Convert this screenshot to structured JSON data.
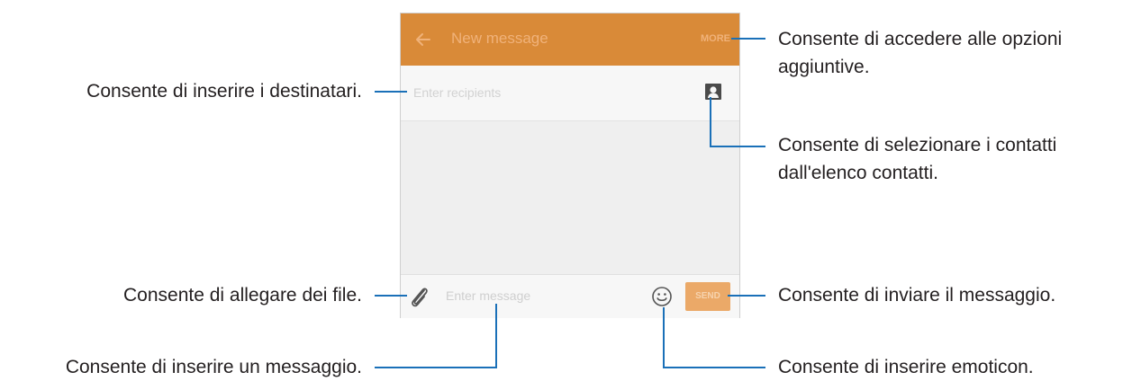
{
  "screen": {
    "appbar": {
      "title": "New message",
      "more_label": "MORE"
    },
    "recipients_placeholder": "Enter recipients",
    "message_placeholder": "Enter message",
    "send_label": "SEND",
    "icons": [
      "back-arrow-icon",
      "contact-picker-icon",
      "paperclip-icon",
      "emoticon-icon"
    ],
    "colors": {
      "appbar": "#d98a38",
      "send_button": "#eba968",
      "leader_lines": "#1a70b8"
    }
  },
  "callouts": {
    "more_options": "Consente di accedere alle opzioni aggiuntive.",
    "recipients": "Consente di inserire i destinatari.",
    "contacts": "Consente di selezionare i contatti dall'elenco contatti.",
    "attach": "Consente di allegare dei file.",
    "send": "Consente di inviare il messaggio.",
    "message": "Consente di inserire un messaggio.",
    "emoticon": "Consente di inserire emoticon."
  }
}
